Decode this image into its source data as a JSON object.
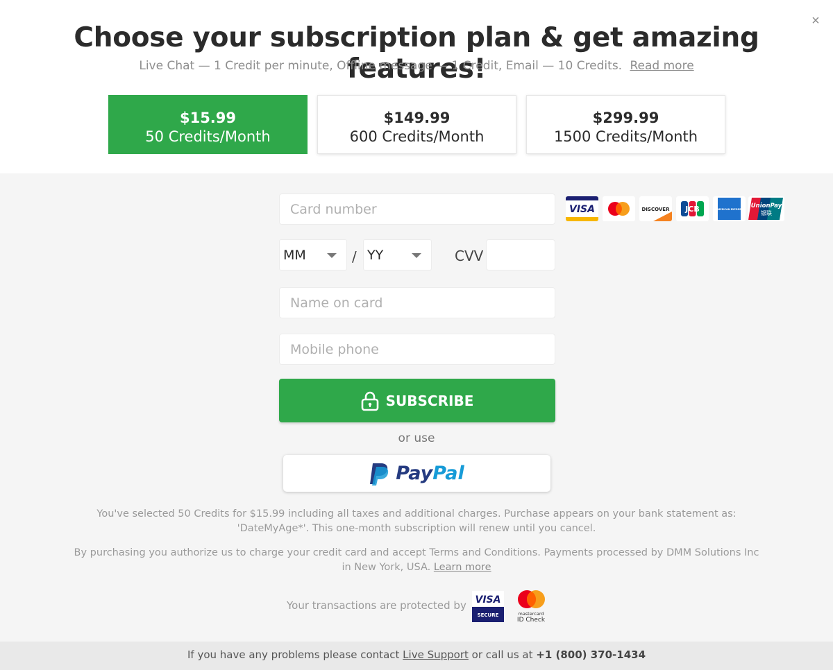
{
  "header": {
    "title": "Choose your subscription plan & get amazing features!",
    "subtitle": "Live Chat — 1 Credit per minute, Offline message — 1 Credit, Email — 10 Credits.",
    "read_more": "Read more",
    "close_symbol": "×"
  },
  "plans": [
    {
      "price": "$15.99",
      "credits": "50 Credits/Month",
      "selected": true
    },
    {
      "price": "$149.99",
      "credits": "600 Credits/Month",
      "selected": false
    },
    {
      "price": "$299.99",
      "credits": "1500 Credits/Month",
      "selected": false
    }
  ],
  "form": {
    "card_number_placeholder": "Card number",
    "month_value": "MM",
    "year_value": "YY",
    "date_separator": "/",
    "cvv_label": "CVV",
    "name_placeholder": "Name on card",
    "phone_placeholder": "Mobile phone",
    "subscribe_label": "SUBSCRIBE",
    "or_use": "or use",
    "paypal_pay": "Pay",
    "paypal_pal": "Pal"
  },
  "card_logos": {
    "visa": "VISA",
    "discover": "DISCOVER",
    "jcb": "JCB",
    "amex": "AMERICAN EXPRESS",
    "unionpay": "UnionPay",
    "unionpay_cn": "银联"
  },
  "notes": {
    "selection_line1": "You've selected 50 Credits for $15.99 including all taxes and additional charges. Purchase appears on your bank statement as:",
    "selection_line2": "'DateMyAge*'. This one-month subscription will renew until you cancel.",
    "auth_line1": "By purchasing you authorize us to charge your credit card and accept Terms and Conditions. Payments processed by DMM Solutions Inc",
    "auth_line2": "in New York, USA.",
    "learn_more": "Learn more",
    "protected_by": "Your transactions are protected by",
    "visa_secure_top": "VISA",
    "visa_secure_bottom": "SECURE",
    "mc_line1": "mastercard",
    "mc_line2": "ID Check"
  },
  "footer": {
    "text_before": "If you have any problems please contact",
    "live_support": "Live Support",
    "text_middle": "or call us at",
    "phone": "+1 (800) 370-1434"
  },
  "colors": {
    "accent_green": "#2fa84a",
    "paypal_dark": "#253b80",
    "paypal_light": "#179bd7"
  }
}
